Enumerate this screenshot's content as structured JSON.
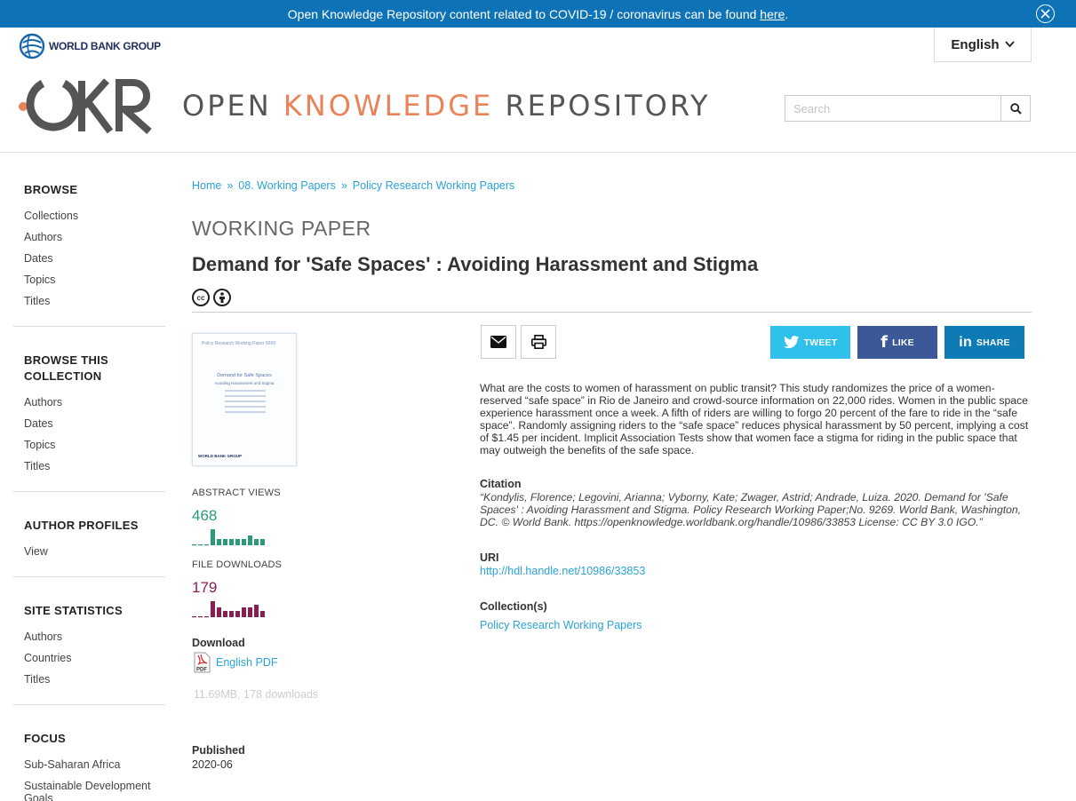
{
  "banner": {
    "text": "Open Knowledge Repository content related to COVID-19 / coronavirus can be found ",
    "link": "here",
    "suffix": "."
  },
  "header": {
    "org_name": "WORLD BANK GROUP",
    "language": "English",
    "site_title": {
      "part1": "OPEN ",
      "part2": "KNOWLEDGE",
      "part3": " REPOSITORY"
    },
    "search_placeholder": "Search"
  },
  "sidebar": {
    "sections": [
      {
        "heading": "BROWSE",
        "items": [
          "Collections",
          "Authors",
          "Dates",
          "Topics",
          "Titles"
        ]
      },
      {
        "heading": "BROWSE THIS COLLECTION",
        "items": [
          "Authors",
          "Dates",
          "Topics",
          "Titles"
        ]
      },
      {
        "heading": "AUTHOR PROFILES",
        "items": [
          "View"
        ]
      },
      {
        "heading": "SITE STATISTICS",
        "items": [
          "Authors",
          "Countries",
          "Titles"
        ]
      },
      {
        "heading": "FOCUS",
        "items": [
          "Sub-Saharan Africa",
          "Sustainable Development Goals"
        ]
      }
    ]
  },
  "breadcrumb": {
    "items": [
      "Home",
      "08. Working Papers",
      "Policy Research Working Papers"
    ],
    "separator": "»"
  },
  "document": {
    "type": "WORKING PAPER",
    "title": "Demand for 'Safe Spaces' : Avoiding Harassment and Stigma",
    "thumbnail": {
      "series": "Policy Research Working Paper     9269",
      "title": "Demand for Safe Spaces",
      "subtitle": "Avoiding Harassment and Stigma",
      "publisher": "WORLD BANK GROUP"
    },
    "abstract": "What are the costs to women of harassment on public transit? This study randomizes the price of a women-reserved “safe space” in Rio de Janeiro and crowd-source information on 22,000 rides. Women in the public space experience harassment once a week. A fifth of riders are willing to forgo 20 percent of the fare to ride in the “safe space”. Randomly assigning riders to the “safe space” reduces physical harassment by 50 percent, implying a cost of $1.45 per incident. Implicit Association Tests show that women face a stigma for riding in the public space that may outweigh the benefits of the safe space.",
    "citation_heading": "Citation",
    "citation": "“Kondylis, Florence; Legovini, Arianna; Vyborny, Kate; Zwager, Astrid; Andrade, Luiza. 2020. Demand for 'Safe Spaces' : Avoiding Harassment and Stigma. Policy Research Working Paper;No. 9269. World Bank, Washington, DC. © World Bank. https://openknowledge.worldbank.org/handle/10986/33853 License: CC BY 3.0 IGO.”",
    "uri_heading": "URI",
    "uri": "http://hdl.handle.net/10986/33853",
    "collections_heading": "Collection(s)",
    "collection": "Policy Research Working Papers",
    "published_heading": "Published",
    "published": "2020-06"
  },
  "stats": {
    "abstract_views_label": "ABSTRACT VIEWS",
    "abstract_views": "468",
    "abstract_color": "#2a9a7a",
    "abstract_spark": [
      0,
      0,
      0,
      5,
      2,
      2,
      2,
      2,
      2,
      3,
      2,
      2
    ],
    "file_downloads_label": "FILE DOWNLOADS",
    "file_downloads": "179",
    "downloads_color": "#8a1e53",
    "downloads_spark": [
      0,
      0,
      0,
      5,
      3,
      2,
      2,
      2,
      3,
      3,
      4,
      2
    ]
  },
  "download": {
    "heading": "Download",
    "link": "English PDF",
    "meta": "11.69MB, 178 downloads"
  },
  "share": {
    "tweet": "TWEET",
    "like": "LIKE",
    "share": "SHARE",
    "tweet_color": "#2fc1eb",
    "like_color": "#3b5998",
    "share_color": "#0e7ab6"
  }
}
